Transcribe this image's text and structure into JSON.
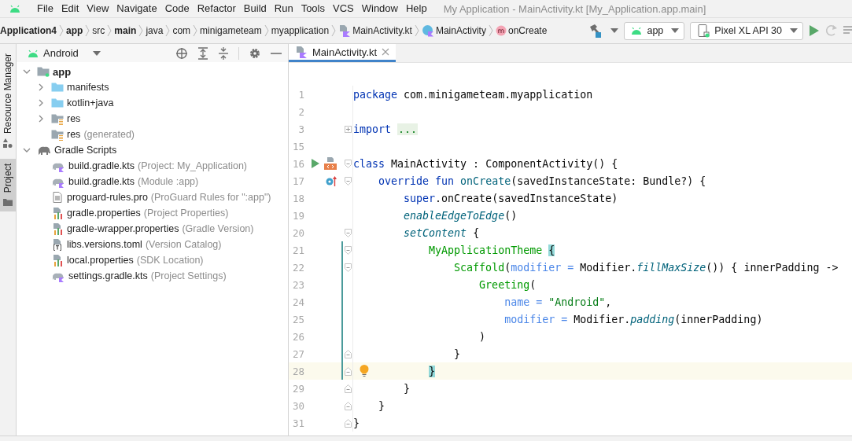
{
  "menu": [
    {
      "label": "File"
    },
    {
      "label": "Edit"
    },
    {
      "label": "View"
    },
    {
      "label": "Navigate"
    },
    {
      "label": "Code"
    },
    {
      "label": "Refactor"
    },
    {
      "label": "Build"
    },
    {
      "label": "Run"
    },
    {
      "label": "Tools"
    },
    {
      "label": "VCS"
    },
    {
      "label": "Window"
    },
    {
      "label": "Help"
    }
  ],
  "window": {
    "title": "My Application - MainActivity.kt [My_Application.app.main]"
  },
  "breadcrumb": [
    {
      "label": "Application4",
      "kind": "project",
      "bold": true
    },
    {
      "label": "app",
      "kind": "folder",
      "bold": true
    },
    {
      "label": "src",
      "kind": "folder",
      "bold": false
    },
    {
      "label": "main",
      "kind": "folder",
      "bold": true
    },
    {
      "label": "java",
      "kind": "folder",
      "bold": false
    },
    {
      "label": "com",
      "kind": "folder",
      "bold": false
    },
    {
      "label": "minigameteam",
      "kind": "folder",
      "bold": false
    },
    {
      "label": "myapplication",
      "kind": "folder",
      "bold": false
    },
    {
      "label": "MainActivity.kt",
      "kind": "file",
      "bold": false
    },
    {
      "label": "MainActivity",
      "kind": "class",
      "bold": false
    },
    {
      "label": "onCreate",
      "kind": "method",
      "bold": false
    }
  ],
  "run_config": {
    "label": "app"
  },
  "device": {
    "label": "Pixel XL API 30"
  },
  "actions": [
    {
      "kind": "run",
      "disabled": false
    },
    {
      "kind": "rerun",
      "disabled": true
    },
    {
      "kind": "more",
      "disabled": false
    }
  ],
  "tool_strip": [
    {
      "label": "Resource Manager",
      "kind": "resources",
      "selected": false
    },
    {
      "label": "Project",
      "kind": "project",
      "selected": true
    }
  ],
  "project": {
    "view": "Android",
    "tree": [
      {
        "label": "app",
        "kind": "module",
        "expanded": true,
        "children": [
          {
            "label": "manifests",
            "kind": "folder",
            "expanded": false
          },
          {
            "label": "kotlin+java",
            "kind": "folder",
            "expanded": false
          },
          {
            "label": "res",
            "kind": "res",
            "expanded": false
          },
          {
            "label": "res",
            "hint": "(generated)",
            "kind": "res"
          }
        ]
      },
      {
        "label": "Gradle Scripts",
        "kind": "gradle",
        "expanded": true,
        "children": [
          {
            "label": "build.gradle.kts",
            "hint": "(Project: My_Application)",
            "kind": "gradle-file"
          },
          {
            "label": "build.gradle.kts",
            "hint": "(Module :app)",
            "kind": "gradle-file"
          },
          {
            "label": "proguard-rules.pro",
            "hint": "(ProGuard Rules for \":app\")",
            "kind": "text"
          },
          {
            "label": "gradle.properties",
            "hint": "(Project Properties)",
            "kind": "properties"
          },
          {
            "label": "gradle-wrapper.properties",
            "hint": "(Gradle Version)",
            "kind": "properties"
          },
          {
            "label": "libs.versions.toml",
            "hint": "(Version Catalog)",
            "kind": "toml"
          },
          {
            "label": "local.properties",
            "hint": "(SDK Location)",
            "kind": "properties"
          },
          {
            "label": "settings.gradle.kts",
            "hint": "(Project Settings)",
            "kind": "gradle-file"
          }
        ]
      }
    ]
  },
  "editor": {
    "tabs": [
      {
        "label": "MainActivity.kt",
        "selected": true
      }
    ],
    "lines": [
      {
        "number": "1",
        "kind": "plain",
        "current": false,
        "scoped": false,
        "tokens": [
          {
            "kind": "keyword",
            "text": "package "
          },
          {
            "kind": "plain",
            "text": "com.minigameteam.myapplication"
          }
        ]
      },
      {
        "number": "2",
        "kind": "plain",
        "current": false,
        "scoped": false
      },
      {
        "number": "3",
        "kind": "fold-collapsed",
        "current": false,
        "scoped": false,
        "tokens": [
          {
            "kind": "keyword",
            "text": "import "
          },
          {
            "kind": "folded",
            "text": "..."
          }
        ]
      },
      {
        "number": "15",
        "kind": "plain",
        "current": false,
        "scoped": false
      },
      {
        "number": "16",
        "kind": "fold-start",
        "current": false,
        "scoped": false,
        "gutter": [
          {
            "kind": "run"
          },
          {
            "kind": "preview"
          }
        ],
        "tokens": [
          {
            "kind": "keyword",
            "text": "class "
          },
          {
            "kind": "plain",
            "text": "MainActivity : ComponentActivity() {"
          }
        ]
      },
      {
        "number": "17",
        "kind": "fold-start",
        "current": false,
        "scoped": false,
        "gutter": [
          {
            "kind": "override"
          }
        ],
        "tokens": [
          {
            "kind": "keyword",
            "text": "    override fun "
          },
          {
            "kind": "declaration",
            "text": "onCreate"
          },
          {
            "kind": "plain",
            "text": "(savedInstanceState: Bundle?) {"
          }
        ]
      },
      {
        "number": "18",
        "kind": "plain",
        "current": false,
        "scoped": false,
        "tokens": [
          {
            "kind": "keyword",
            "text": "        super"
          },
          {
            "kind": "plain",
            "text": ".onCreate(savedInstanceState)"
          }
        ]
      },
      {
        "number": "19",
        "kind": "plain",
        "current": false,
        "scoped": false,
        "tokens": [
          {
            "kind": "extension",
            "text": "        enableEdgeToEdge"
          },
          {
            "kind": "plain",
            "text": "()"
          }
        ]
      },
      {
        "number": "20",
        "kind": "fold-start",
        "current": false,
        "scoped": false,
        "tokens": [
          {
            "kind": "extension",
            "text": "        setContent"
          },
          {
            "kind": "plain",
            "text": " {"
          }
        ]
      },
      {
        "number": "21",
        "kind": "fold-start",
        "current": false,
        "scoped": true,
        "tokens": [
          {
            "kind": "composable",
            "text": "            MyApplicationTheme"
          },
          {
            "kind": "brace",
            "text": " {"
          }
        ]
      },
      {
        "number": "22",
        "kind": "fold-start",
        "current": false,
        "scoped": true,
        "tokens": [
          {
            "kind": "composable",
            "text": "                Scaffold"
          },
          {
            "kind": "plain",
            "text": "("
          },
          {
            "kind": "named",
            "text": "modifier = "
          },
          {
            "kind": "plain",
            "text": "Modifier."
          },
          {
            "kind": "extension",
            "text": "fillMaxSize"
          },
          {
            "kind": "plain",
            "text": "()) { innerPadding ->"
          }
        ]
      },
      {
        "number": "23",
        "kind": "plain",
        "current": false,
        "scoped": true,
        "tokens": [
          {
            "kind": "composable",
            "text": "                    Greeting"
          },
          {
            "kind": "plain",
            "text": "("
          }
        ]
      },
      {
        "number": "24",
        "kind": "plain",
        "current": false,
        "scoped": true,
        "tokens": [
          {
            "kind": "named",
            "text": "                        name = "
          },
          {
            "kind": "string",
            "text": "\"Android\""
          },
          {
            "kind": "plain",
            "text": ","
          }
        ]
      },
      {
        "number": "25",
        "kind": "plain",
        "current": false,
        "scoped": true,
        "tokens": [
          {
            "kind": "named",
            "text": "                        modifier = "
          },
          {
            "kind": "plain",
            "text": "Modifier."
          },
          {
            "kind": "extension",
            "text": "padding"
          },
          {
            "kind": "plain",
            "text": "(innerPadding)"
          }
        ]
      },
      {
        "number": "26",
        "kind": "plain",
        "current": false,
        "scoped": true,
        "tokens": [
          {
            "kind": "plain",
            "text": "                    )"
          }
        ]
      },
      {
        "number": "27",
        "kind": "fold-end",
        "current": false,
        "scoped": true,
        "tokens": [
          {
            "kind": "plain",
            "text": "                }"
          }
        ]
      },
      {
        "number": "28",
        "kind": "fold-end",
        "current": true,
        "scoped": true,
        "gutter": [
          {
            "kind": "bulb"
          }
        ],
        "tokens": [
          {
            "kind": "brace",
            "text": "            }"
          }
        ]
      },
      {
        "number": "29",
        "kind": "fold-end",
        "current": false,
        "scoped": false,
        "tokens": [
          {
            "kind": "plain",
            "text": "        }"
          }
        ]
      },
      {
        "number": "30",
        "kind": "fold-end",
        "current": false,
        "scoped": false,
        "tokens": [
          {
            "kind": "plain",
            "text": "    }"
          }
        ]
      },
      {
        "number": "31",
        "kind": "fold-end",
        "current": false,
        "scoped": false,
        "tokens": [
          {
            "kind": "plain",
            "text": "}"
          }
        ]
      }
    ]
  }
}
